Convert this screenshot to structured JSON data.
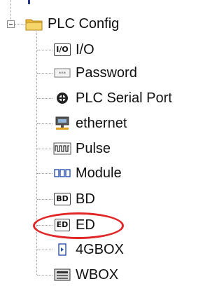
{
  "tree": {
    "root": {
      "label": "PLC Config",
      "icon": "folder-icon",
      "expanded": true
    },
    "children": [
      {
        "label": "I/O",
        "icon": "io-icon",
        "badge": "I/O"
      },
      {
        "label": "Password",
        "icon": "password-icon"
      },
      {
        "label": "PLC Serial Port",
        "icon": "serial-port-icon"
      },
      {
        "label": "ethernet",
        "icon": "ethernet-icon"
      },
      {
        "label": "Pulse",
        "icon": "pulse-icon"
      },
      {
        "label": "Module",
        "icon": "module-icon"
      },
      {
        "label": "BD",
        "icon": "bd-icon",
        "badge": "BD"
      },
      {
        "label": "ED",
        "icon": "ed-icon",
        "badge": "ED",
        "annotated": true
      },
      {
        "label": "4GBOX",
        "icon": "4gbox-icon"
      },
      {
        "label": "WBOX",
        "icon": "wbox-icon"
      }
    ]
  },
  "colors": {
    "annotation": "#e02626",
    "tree_lines": "#9a9a9a",
    "folder": "#f2c94c"
  }
}
